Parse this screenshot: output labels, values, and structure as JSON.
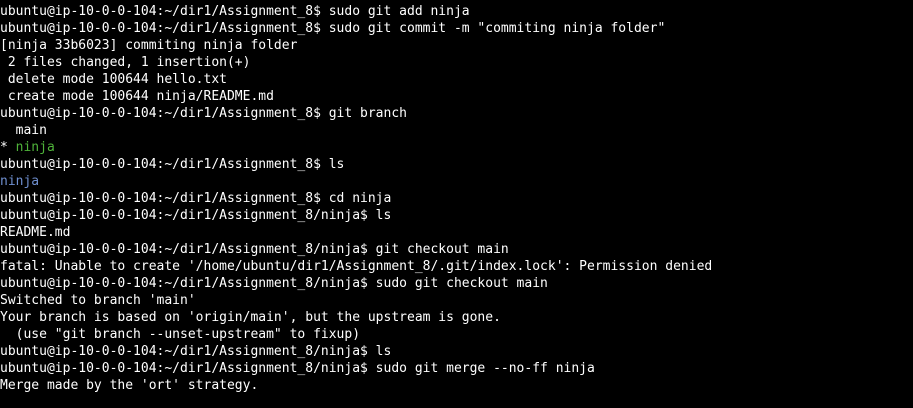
{
  "colors": {
    "background": "#000000",
    "foreground": "#ffffff",
    "current_branch": "#4fb33a",
    "directory": "#6f8fcf"
  },
  "lines": [
    {
      "text": "ubuntu@ip-10-0-0-104:~/dir1/Assignment_8$ sudo git add ninja"
    },
    {
      "text": "ubuntu@ip-10-0-0-104:~/dir1/Assignment_8$ sudo git commit -m \"commiting ninja folder\""
    },
    {
      "text": "[ninja 33b6023] commiting ninja folder"
    },
    {
      "text": " 2 files changed, 1 insertion(+)"
    },
    {
      "text": " delete mode 100644 hello.txt"
    },
    {
      "text": " create mode 100644 ninja/README.md"
    },
    {
      "text": "ubuntu@ip-10-0-0-104:~/dir1/Assignment_8$ git branch"
    },
    {
      "text": "  main"
    },
    {
      "prefix": "* ",
      "highlight": "ninja"
    },
    {
      "text": "ubuntu@ip-10-0-0-104:~/dir1/Assignment_8$ ls"
    },
    {
      "dir": "ninja"
    },
    {
      "text": "ubuntu@ip-10-0-0-104:~/dir1/Assignment_8$ cd ninja"
    },
    {
      "text": "ubuntu@ip-10-0-0-104:~/dir1/Assignment_8/ninja$ ls"
    },
    {
      "text": "README.md"
    },
    {
      "text": "ubuntu@ip-10-0-0-104:~/dir1/Assignment_8/ninja$ git checkout main"
    },
    {
      "text": "fatal: Unable to create '/home/ubuntu/dir1/Assignment_8/.git/index.lock': Permission denied"
    },
    {
      "text": "ubuntu@ip-10-0-0-104:~/dir1/Assignment_8/ninja$ sudo git checkout main"
    },
    {
      "text": "Switched to branch 'main'"
    },
    {
      "text": "Your branch is based on 'origin/main', but the upstream is gone."
    },
    {
      "text": "  (use \"git branch --unset-upstream\" to fixup)"
    },
    {
      "text": "ubuntu@ip-10-0-0-104:~/dir1/Assignment_8/ninja$ ls"
    },
    {
      "text": "ubuntu@ip-10-0-0-104:~/dir1/Assignment_8/ninja$ sudo git merge --no-ff ninja"
    },
    {
      "text": "Merge made by the 'ort' strategy."
    }
  ]
}
